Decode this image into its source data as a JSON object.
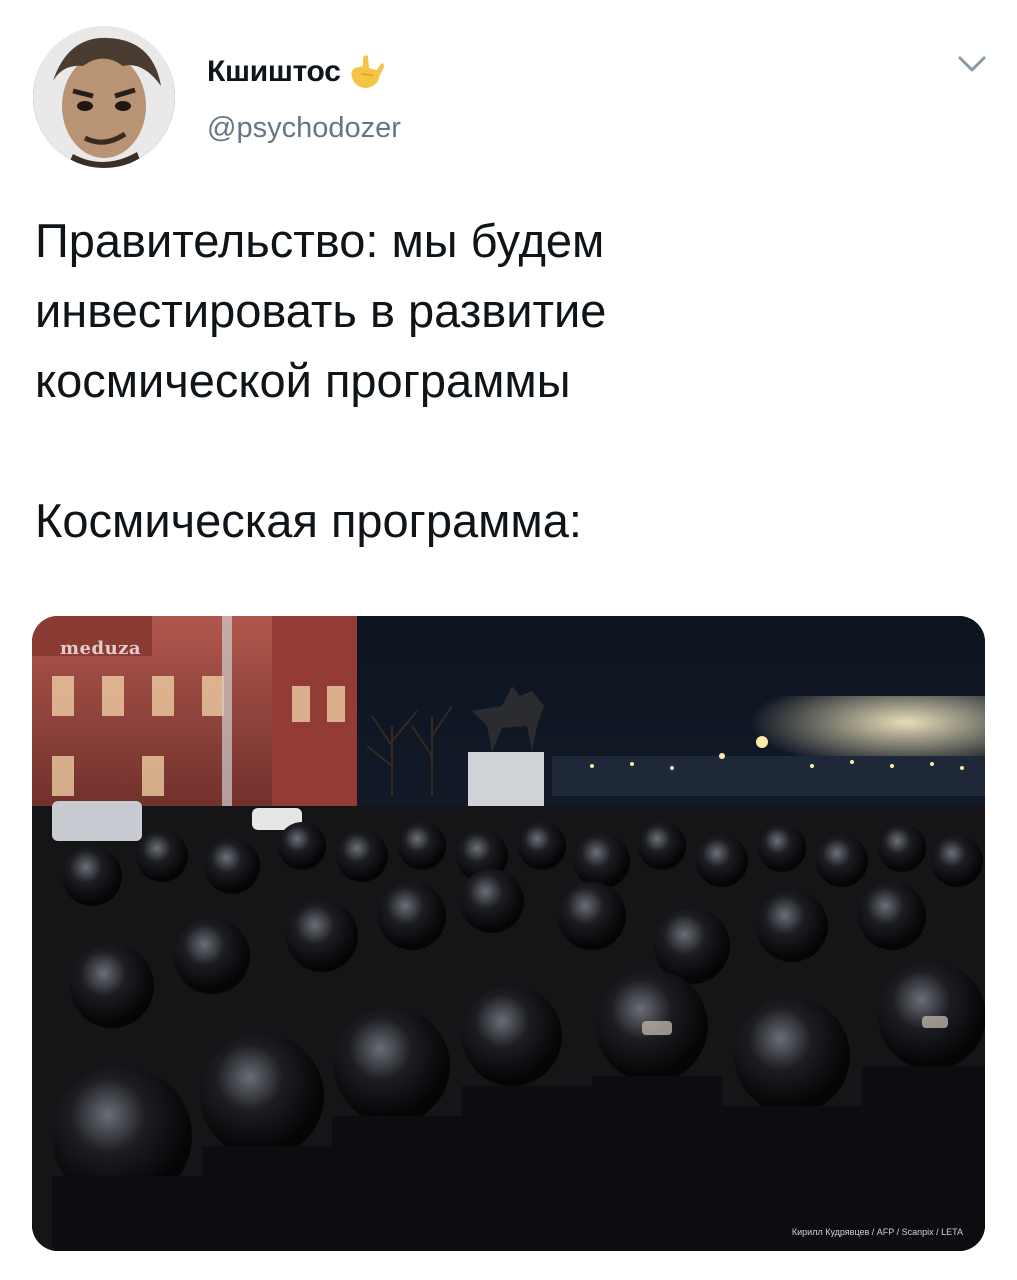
{
  "user": {
    "display_name": "Кшиштос",
    "handle": "@psychodozer",
    "name_emoji_icon": "call-me-hand-emoji"
  },
  "header": {
    "menu_icon": "chevron-down-icon"
  },
  "tweet": {
    "text": "Правительство: мы будем\nинвестировать в развитие\nкосмической программы\n\nКосмическая программа:"
  },
  "media": {
    "description": "Night photo of riot police crowd in front of a red brick building and an equestrian statue",
    "watermark": "meduza",
    "credit": "Кирилл Кудрявцев / AFP / Scanpix / LETA"
  },
  "colors": {
    "text": "#0f1419",
    "secondary": "#657786",
    "emoji": "#f6c344"
  }
}
